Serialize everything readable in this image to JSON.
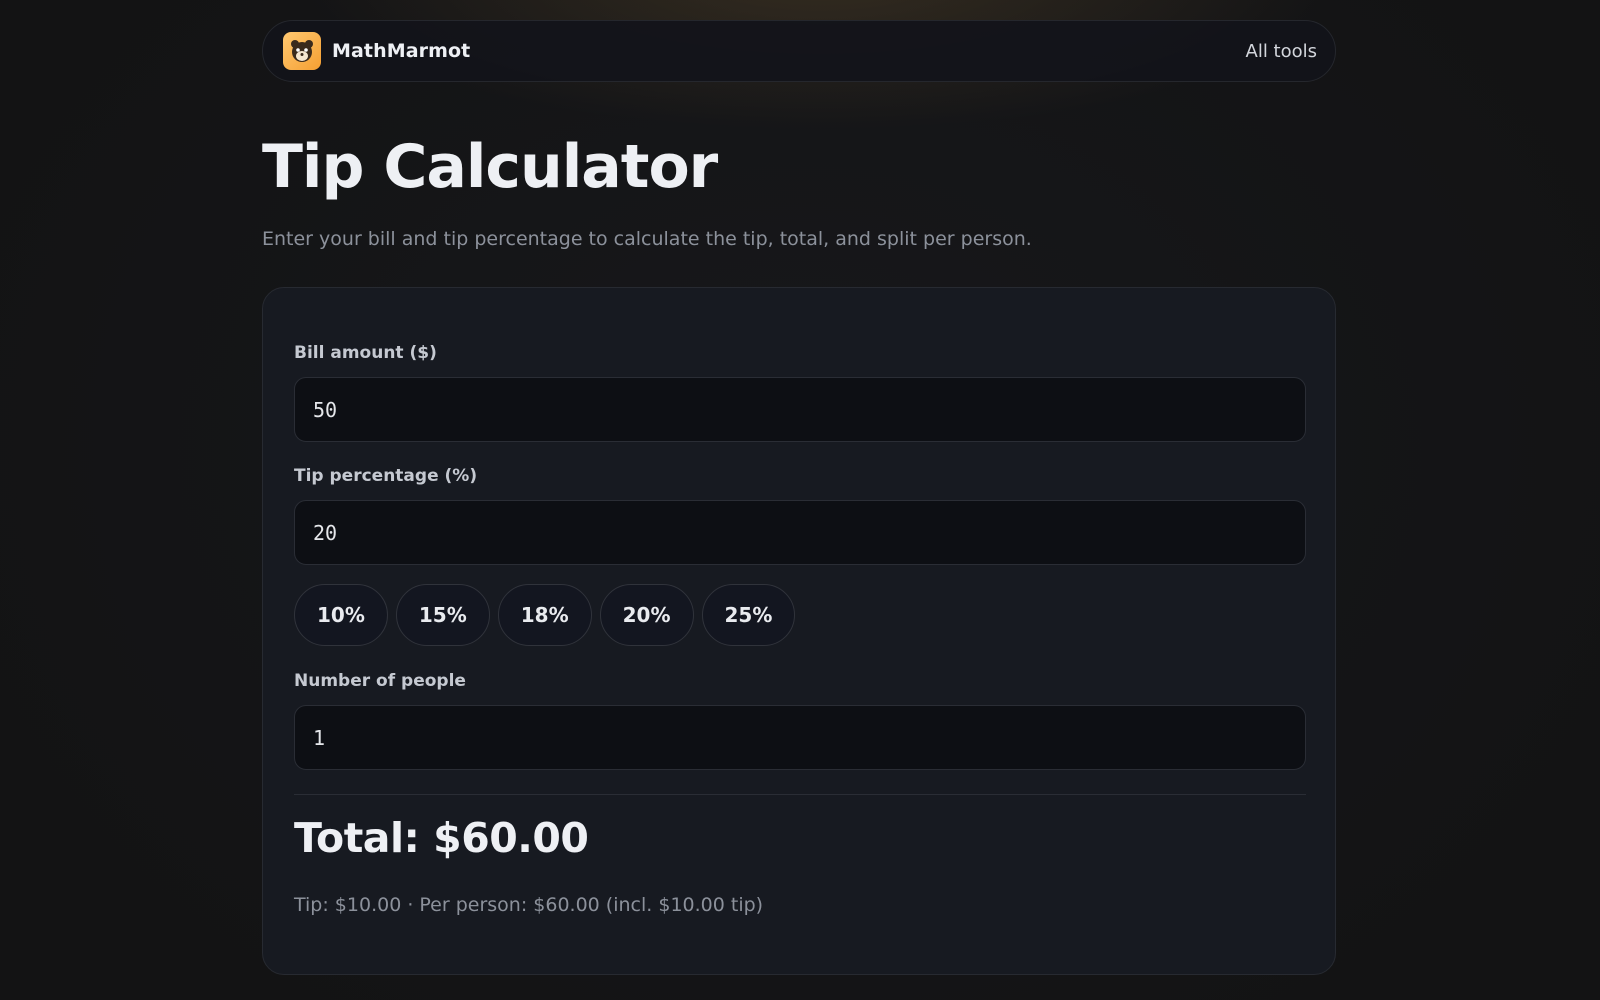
{
  "nav": {
    "brand": "MathMarmot",
    "logo_icon": "marmot-logo-icon",
    "link": "All tools"
  },
  "page": {
    "title": "Tip Calculator",
    "subtitle": "Enter your bill and tip percentage to calculate the tip, total, and split per person."
  },
  "form": {
    "bill_label": "Bill amount ($)",
    "bill_value": "50",
    "tip_label": "Tip percentage (%)",
    "tip_value": "20",
    "presets": [
      "10%",
      "15%",
      "18%",
      "20%",
      "25%"
    ],
    "people_label": "Number of people",
    "people_value": "1"
  },
  "result": {
    "total": "Total: $60.00",
    "breakdown": "Tip: $10.00 · Per person: $60.00 (incl. $10.00 tip)"
  },
  "colors": {
    "accent": "#f7a83c",
    "background": "#131314",
    "card": "#171a21",
    "input": "#0d0f14"
  }
}
